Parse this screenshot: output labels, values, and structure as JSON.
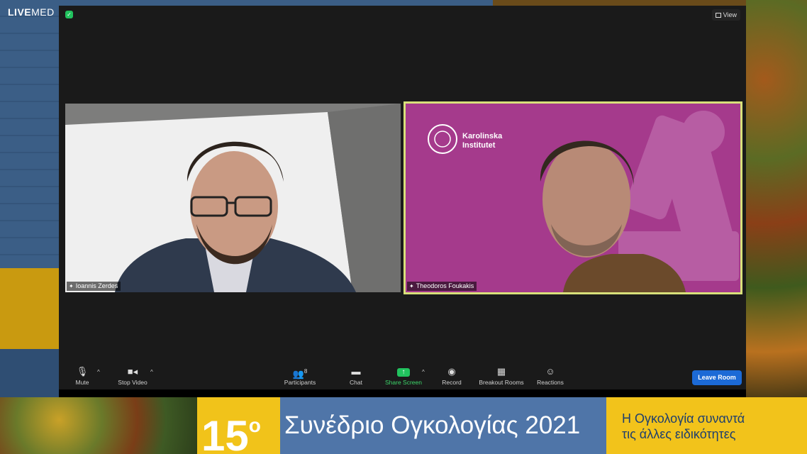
{
  "logo": {
    "text_bold": "LIVE",
    "text_light": "MED"
  },
  "meeting": {
    "view_label": "View",
    "participants": [
      {
        "name": "Ioannis Zerdes"
      },
      {
        "name": "Theodoros Foukakis",
        "active_speaker": true,
        "background_logo": "Karolinska Institutet"
      }
    ]
  },
  "toolbar": {
    "mute": "Mute",
    "stop_video": "Stop Video",
    "participants": "Participants",
    "participants_count": "8",
    "chat": "Chat",
    "share_screen": "Share Screen",
    "record": "Record",
    "breakout_rooms": "Breakout Rooms",
    "reactions": "Reactions",
    "leave": "Leave Room"
  },
  "banner": {
    "number": "15",
    "degree": "ο",
    "title": "Συνέδριο Ογκολογίας 2021",
    "tagline_line1": "Η Ογκολογία συναντά",
    "tagline_line2": "τις άλλες ειδικότητες"
  },
  "colors": {
    "share_green": "#21c25e",
    "leave_blue": "#1c6ad6",
    "active_border": "#d8e07a",
    "banner_blue": "#4f75a8",
    "banner_gold": "#f2c31b"
  },
  "icons": [
    "shield-icon",
    "microphone-icon",
    "camera-icon",
    "participants-icon",
    "chat-icon",
    "share-screen-icon",
    "record-icon",
    "breakout-rooms-icon",
    "reactions-icon",
    "pin-icon",
    "grid-icon"
  ]
}
